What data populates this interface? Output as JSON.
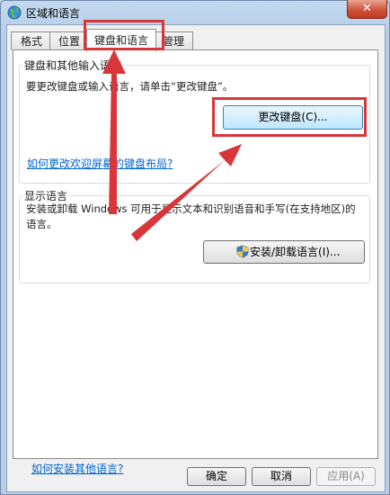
{
  "window": {
    "title": "区域和语言",
    "close_glyph": "✕"
  },
  "tabs": [
    {
      "label": "格式",
      "active": false
    },
    {
      "label": "位置",
      "active": false
    },
    {
      "label": "键盘和语言",
      "active": true
    },
    {
      "label": "管理",
      "active": false
    }
  ],
  "keyboard_group": {
    "title": "键盘和其他输入语言",
    "description": "要更改键盘或输入语言，请单击“更改键盘”。",
    "change_button": "更改键盘(C)...",
    "link": "如何更改欢迎屏幕的键盘布局?"
  },
  "display_group": {
    "title": "显示语言",
    "description": "安装或卸载 Windows 可用于显示文本和识别语音和手写(在支持地区)的语言。",
    "install_button": "安装/卸载语言(I)..."
  },
  "bottom_link": "如何安装其他语言?",
  "footer": {
    "ok": "确定",
    "cancel": "取消",
    "apply": "应用(A)"
  },
  "annotation_color": "#d9363a",
  "icons": [
    "globe-icon",
    "close-icon",
    "shield-icon"
  ]
}
